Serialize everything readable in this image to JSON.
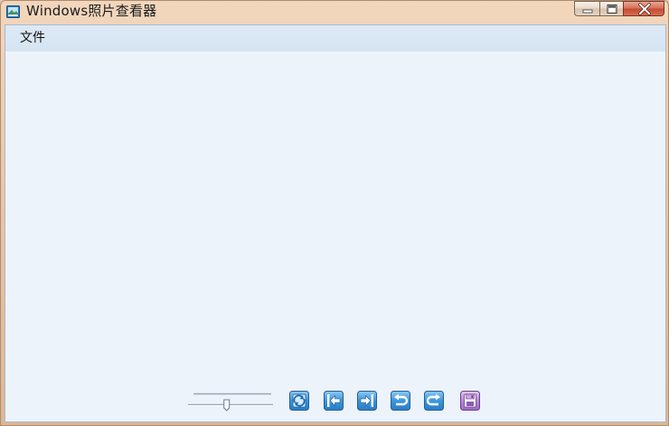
{
  "window": {
    "title": "Windows照片查看器"
  },
  "menu": {
    "items": [
      {
        "label": "文件"
      }
    ]
  },
  "toolbar": {
    "zoom_level": 0.45,
    "buttons": [
      {
        "name": "actual-size-button",
        "icon": "fit-to-window-icon"
      },
      {
        "name": "previous-button",
        "icon": "previous-arrow-icon"
      },
      {
        "name": "next-button",
        "icon": "next-arrow-icon"
      },
      {
        "name": "rotate-counterclockwise-button",
        "icon": "rotate-left-icon"
      },
      {
        "name": "rotate-clockwise-button",
        "icon": "rotate-right-icon"
      },
      {
        "name": "delete-button",
        "icon": "save-disk-icon"
      }
    ]
  },
  "colors": {
    "titlebar": "#e9c6a6",
    "client_bg": "#edf3fa",
    "menubar_bg": "#d6e4f2",
    "button_blue": "#2d8bd6",
    "close_red": "#c24b31"
  }
}
